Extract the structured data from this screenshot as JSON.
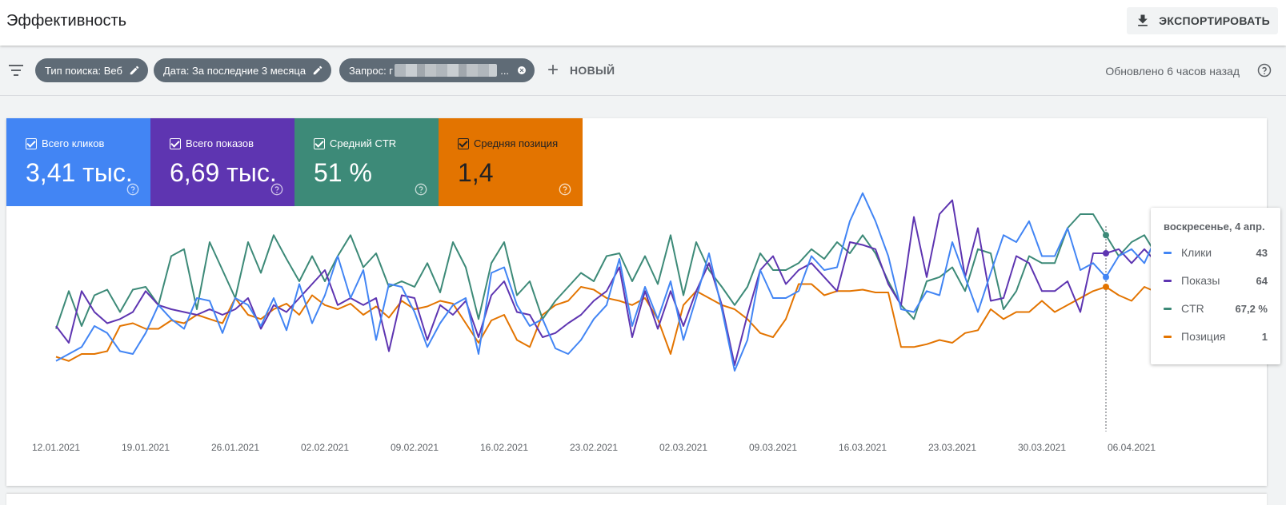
{
  "header": {
    "title": "Эффективность",
    "export_label": "ЭКСПОРТИРОВАТЬ"
  },
  "filters": {
    "search_type": "Тип поиска: Веб",
    "date": "Дата: За последние 3 месяца",
    "query_prefix": "Запрос: г",
    "query_suffix": "...",
    "new_label": "НОВЫЙ",
    "updated": "Обновлено 6 часов назад"
  },
  "metrics": {
    "clicks": {
      "label": "Всего кликов",
      "value": "3,41 тыс."
    },
    "impressions": {
      "label": "Всего показов",
      "value": "6,69 тыс."
    },
    "ctr": {
      "label": "Средний CTR",
      "value": "51 %"
    },
    "position": {
      "label": "Средняя позиция",
      "value": "1,4"
    }
  },
  "colors": {
    "clicks": "#4285f4",
    "impressions": "#5e35b1",
    "ctr": "#3d8a78",
    "position": "#e37400"
  },
  "tooltip": {
    "date": "воскресенье, 4 апр.",
    "rows": [
      {
        "name": "Клики",
        "value": "43",
        "color": "#4285f4"
      },
      {
        "name": "Показы",
        "value": "64",
        "color": "#5e35b1"
      },
      {
        "name": "CTR",
        "value": "67,2 %",
        "color": "#3d8a78"
      },
      {
        "name": "Позиция",
        "value": "1",
        "color": "#e37400"
      }
    ]
  },
  "chart_data": {
    "type": "line",
    "x_tick_labels": [
      "12.01.2021",
      "19.01.2021",
      "26.01.2021",
      "02.02.2021",
      "09.02.2021",
      "16.02.2021",
      "23.02.2021",
      "02.03.2021",
      "09.03.2021",
      "16.03.2021",
      "23.03.2021",
      "30.03.2021",
      "06.04.2021"
    ],
    "highlight_index": 82,
    "series": [
      {
        "name": "Клики",
        "key": "clicks",
        "values": [
          0.15,
          0.2,
          0.25,
          0.4,
          0.35,
          0.22,
          0.2,
          0.35,
          0.55,
          0.45,
          0.38,
          0.6,
          0.58,
          0.35,
          0.6,
          0.55,
          0.4,
          0.6,
          0.37,
          0.7,
          0.42,
          0.62,
          0.9,
          0.6,
          0.8,
          0.3,
          0.7,
          0.68,
          0.5,
          0.25,
          0.42,
          0.55,
          0.6,
          0.2,
          0.78,
          0.82,
          0.55,
          0.4,
          0.45,
          0.24,
          0.2,
          0.3,
          0.45,
          0.55,
          0.88,
          0.4,
          0.68,
          0.45,
          0.72,
          0.3,
          0.6,
          0.92,
          0.52,
          0.08,
          0.3,
          0.8,
          0.6,
          0.6,
          0.65,
          0.9,
          0.8,
          0.82,
          1.15,
          1.35,
          1.15,
          0.9,
          0.52,
          0.5,
          0.65,
          0.62,
          1.0,
          0.75,
          0.5,
          0.78,
          1.05,
          1.0,
          1.15,
          0.9,
          0.9,
          1.1,
          0.8,
          0.85,
          0.75,
          0.9,
          0.95,
          0.85,
          1.05,
          0.9,
          0.7
        ]
      },
      {
        "name": "Показы",
        "key": "impressions",
        "values": [
          0.4,
          0.28,
          0.65,
          0.5,
          0.42,
          0.45,
          0.5,
          0.65,
          0.55,
          0.52,
          0.5,
          0.48,
          0.52,
          0.48,
          0.52,
          0.6,
          0.38,
          0.55,
          0.5,
          0.6,
          0.7,
          0.8,
          0.55,
          0.6,
          0.55,
          0.6,
          0.22,
          0.62,
          0.6,
          0.3,
          0.55,
          0.48,
          0.58,
          0.32,
          0.62,
          0.72,
          0.5,
          0.48,
          0.32,
          0.35,
          0.42,
          0.48,
          0.58,
          0.65,
          0.82,
          0.32,
          0.65,
          0.38,
          0.65,
          0.4,
          0.65,
          0.85,
          0.55,
          0.12,
          0.48,
          0.8,
          0.9,
          0.7,
          0.8,
          0.85,
          0.75,
          0.65,
          1.0,
          0.98,
          0.95,
          0.7,
          0.55,
          1.18,
          0.75,
          1.2,
          1.3,
          0.75,
          1.1,
          0.58,
          0.6,
          0.9,
          0.85,
          0.65,
          0.65,
          0.72,
          0.5,
          0.92,
          0.92,
          0.95,
          0.85,
          0.95,
          0.85,
          0.78,
          0.65
        ]
      },
      {
        "name": "CTR",
        "key": "ctr",
        "values": [
          0.38,
          0.65,
          0.4,
          0.62,
          0.66,
          0.5,
          0.66,
          0.68,
          0.55,
          0.9,
          0.95,
          0.52,
          1.0,
          0.8,
          0.6,
          1.0,
          0.78,
          1.05,
          0.88,
          0.72,
          0.9,
          0.72,
          0.9,
          1.05,
          0.82,
          0.92,
          0.68,
          0.72,
          0.68,
          0.85,
          0.64,
          1.0,
          0.82,
          0.45,
          0.85,
          1.0,
          0.62,
          0.72,
          0.45,
          0.58,
          0.68,
          0.78,
          0.72,
          0.9,
          0.92,
          0.72,
          0.9,
          0.7,
          1.05,
          0.62,
          1.0,
          0.8,
          0.68,
          0.55,
          0.68,
          0.92,
          0.8,
          0.8,
          0.85,
          0.95,
          0.88,
          1.0,
          0.92,
          1.05,
          0.92,
          0.72,
          0.55,
          0.45,
          0.72,
          0.75,
          0.82,
          0.65,
          0.95,
          0.92,
          0.52,
          0.65,
          0.9,
          0.85,
          0.85,
          1.1,
          1.2,
          1.2,
          1.05,
          0.9,
          1.0,
          1.05,
          0.9,
          0.92,
          0.95,
          0.9
        ]
      },
      {
        "name": "Позиция",
        "key": "position",
        "values": [
          0.18,
          0.15,
          0.2,
          0.2,
          0.22,
          0.4,
          0.42,
          0.38,
          0.38,
          0.44,
          0.42,
          0.48,
          0.45,
          0.42,
          0.6,
          0.48,
          0.45,
          0.52,
          0.56,
          0.48,
          0.62,
          0.55,
          0.52,
          0.56,
          0.48,
          0.54,
          0.46,
          0.58,
          0.52,
          0.54,
          0.58,
          0.56,
          0.42,
          0.28,
          0.44,
          0.48,
          0.3,
          0.25,
          0.48,
          0.55,
          0.58,
          0.68,
          0.66,
          0.6,
          0.58,
          0.55,
          0.6,
          0.45,
          0.2,
          0.55,
          0.65,
          0.6,
          0.55,
          0.52,
          0.45,
          0.35,
          0.32,
          0.45,
          0.7,
          0.7,
          0.62,
          0.65,
          0.65,
          0.66,
          0.64,
          0.64,
          0.25,
          0.25,
          0.27,
          0.3,
          0.28,
          0.35,
          0.37,
          0.52,
          0.45,
          0.5,
          0.5,
          0.58,
          0.5,
          0.55,
          0.6,
          0.65,
          0.68,
          0.62,
          0.58,
          0.68,
          0.64,
          0.65,
          0.58
        ]
      }
    ]
  }
}
